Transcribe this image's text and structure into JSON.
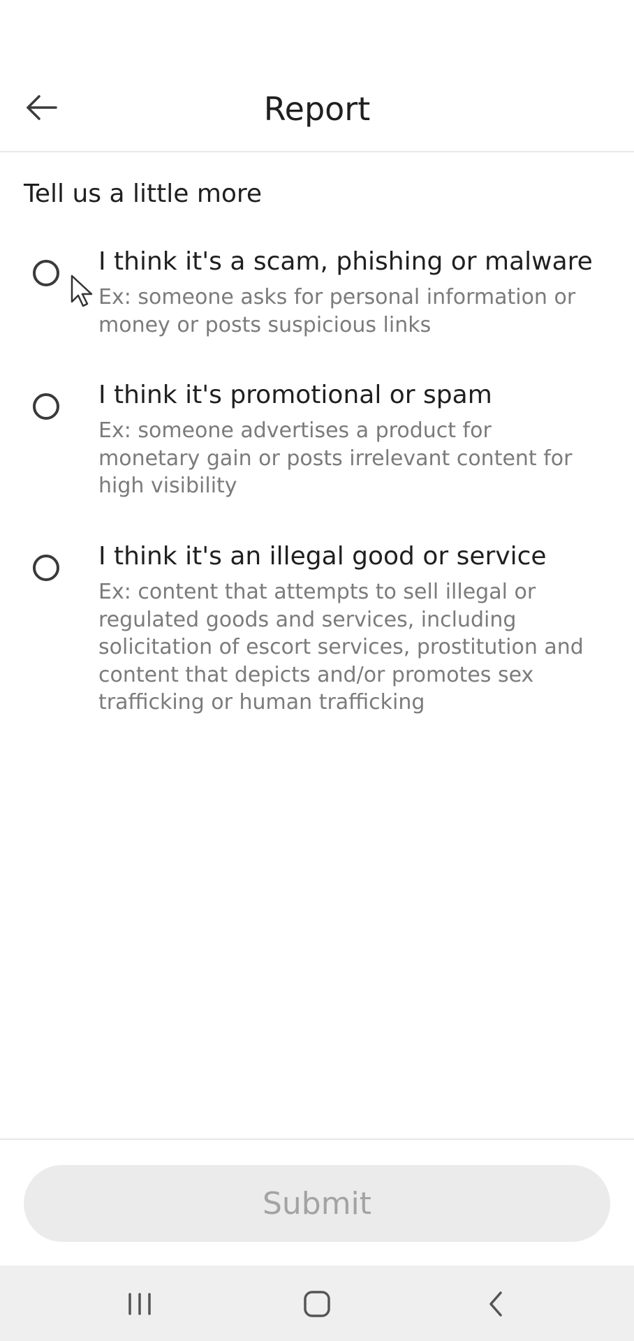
{
  "header": {
    "title": "Report",
    "back_icon": "arrow-left-icon"
  },
  "prompt": "Tell us a little more",
  "options": [
    {
      "title": "I think it's a scam, phishing or malware",
      "description": "Ex: someone asks for personal information or money or posts suspicious links",
      "selected": false
    },
    {
      "title": "I think it's promotional or spam",
      "description": "Ex: someone advertises a product for monetary gain or posts irrelevant content for high visibility",
      "selected": false
    },
    {
      "title": "I think it's an illegal good or service",
      "description": "Ex: content that attempts to sell illegal or regulated goods and services, including solicitation of escort services, prostitution and content that depicts and/or promotes sex trafficking or human trafficking",
      "selected": false
    }
  ],
  "submit": {
    "label": "Submit",
    "enabled": false
  },
  "system_nav": {
    "recents_icon": "recents-icon",
    "home_icon": "home-icon",
    "back_icon": "back-chevron-icon"
  },
  "colors": {
    "text_primary": "#1f1f1f",
    "text_secondary": "#7b7b7b",
    "submit_disabled_bg": "#ebebeb",
    "submit_disabled_text": "#a3a3a3",
    "nav_bar_bg": "#efefef"
  }
}
